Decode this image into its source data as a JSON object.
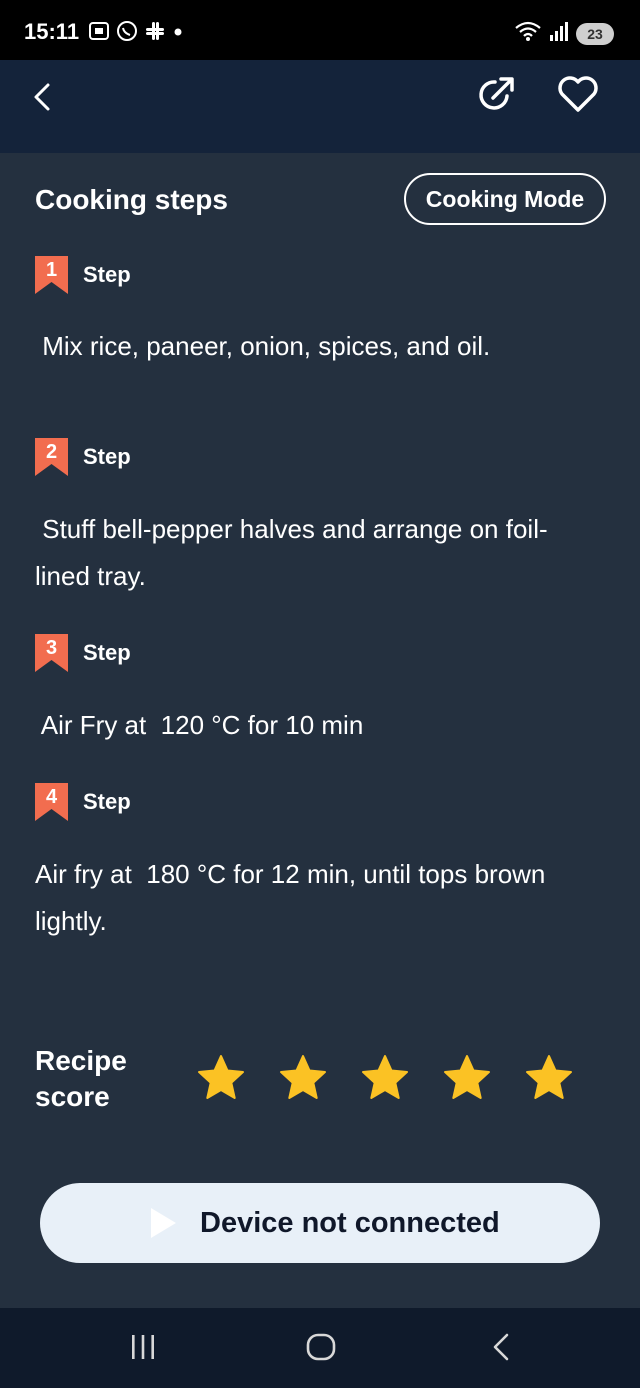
{
  "status_bar": {
    "time": "15:11",
    "battery_level": "23",
    "notification_icons": [
      "screenshot-icon",
      "whatsapp-icon",
      "slack-icon",
      "dot-icon"
    ],
    "status_icons": [
      "wifi-icon",
      "signal-icon",
      "battery-icon"
    ]
  },
  "header": {
    "back_icon": "chevron-left-icon",
    "share_icon": "share-icon",
    "favorite_icon": "heart-icon"
  },
  "content": {
    "title": "Cooking steps",
    "cooking_mode_label": "Cooking Mode",
    "steps": [
      {
        "number": "1",
        "label": "Step",
        "text": " Mix rice, paneer, onion, spices, and oil."
      },
      {
        "number": "2",
        "label": "Step",
        "text": " Stuff bell-pepper halves and arrange on foil-lined tray."
      },
      {
        "number": "3",
        "label": "Step",
        "text": " Air Fry at  120 °C for 10 min"
      },
      {
        "number": "4",
        "label": "Step",
        "text": "Air fry at  180 °C for 12 min, until tops brown lightly."
      }
    ],
    "score_label": "Recipe score",
    "score_value": 5,
    "score_max": 5
  },
  "device_button": {
    "label": "Device not connected",
    "icon": "play-icon"
  },
  "nav_bar": {
    "icons": [
      "recents-icon",
      "home-icon",
      "back-icon"
    ]
  },
  "colors": {
    "background": "#24303f",
    "header": "#14233a",
    "badge": "#f26d4f",
    "star": "#fbc224",
    "device_button": "#e8f0f8"
  }
}
